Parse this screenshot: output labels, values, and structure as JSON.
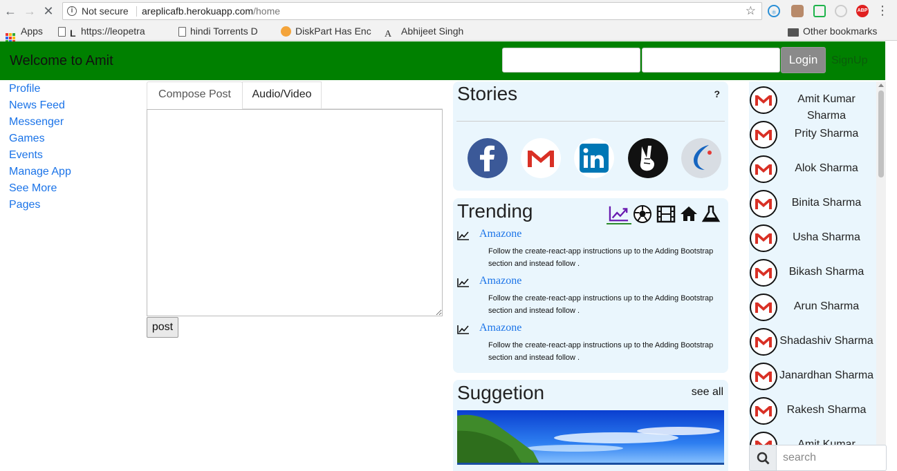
{
  "browser": {
    "security_label": "Not secure",
    "url_host": "areplicafb.herokuapp.com",
    "url_path": "/home",
    "bookmarks": [
      "Apps",
      "https://leopetra",
      "hindi Torrents D",
      "DiskPart Has Enc",
      "Abhijeet Singh"
    ],
    "other_bookmarks": "Other bookmarks",
    "ext_abp": "ABP"
  },
  "header": {
    "brand": "Welcome to Amit",
    "login_label": "Login",
    "signup_label": "SignUp"
  },
  "sidebar": {
    "items": [
      "Profile",
      "News Feed",
      "Messenger",
      "Games",
      "Events",
      "Manage App",
      "See More",
      "Pages"
    ]
  },
  "compose": {
    "tabs": [
      "Compose Post",
      "Audio/Video"
    ],
    "post_label": "post"
  },
  "stories": {
    "title": "Stories",
    "help": "?",
    "icons": [
      "facebook-icon",
      "gmail-icon",
      "linkedin-icon",
      "peace-icon",
      "app-icon"
    ]
  },
  "trending": {
    "title": "Trending",
    "categories": [
      "trend-icon",
      "soccer-icon",
      "film-icon",
      "home-icon",
      "flask-icon"
    ],
    "items": [
      {
        "link": "Amazone",
        "desc": "Follow the create-react-app instructions up to the Adding Bootstrap section and instead follow ."
      },
      {
        "link": "Amazone",
        "desc": "Follow the create-react-app instructions up to the Adding Bootstrap section and instead follow ."
      },
      {
        "link": "Amazone",
        "desc": "Follow the create-react-app instructions up to the Adding Bootstrap section and instead follow ."
      }
    ]
  },
  "suggestion": {
    "title": "Suggetion",
    "see_all": "see all"
  },
  "contacts": {
    "items": [
      {
        "name": "Amit Kumar Sharma"
      },
      {
        "name": "Prity Sharma"
      },
      {
        "name": "Alok Sharma"
      },
      {
        "name": "Binita Sharma"
      },
      {
        "name": "Usha Sharma"
      },
      {
        "name": "Bikash Sharma"
      },
      {
        "name": "Arun Sharma"
      },
      {
        "name": "Shadashiv Sharma"
      },
      {
        "name": "Janardhan Sharma"
      },
      {
        "name": "Rakesh Sharma"
      },
      {
        "name": "Amit Kumar"
      }
    ],
    "search_placeholder": "search"
  },
  "colors": {
    "header_green": "#008000",
    "link_blue": "#1a73e8",
    "card_bg": "#eaf6fd",
    "gmail_red": "#d93025"
  }
}
